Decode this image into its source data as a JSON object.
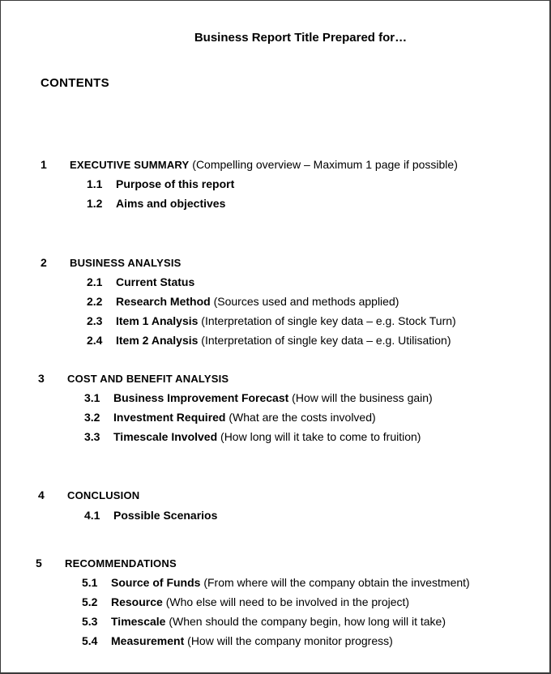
{
  "document": {
    "title": "Business Report Title Prepared for…",
    "contents_heading": "CONTENTS",
    "sections": [
      {
        "number": "1",
        "title": "EXECUTIVE SUMMARY",
        "note": " (Compelling overview – Maximum 1 page if possible)",
        "items": [
          {
            "number": "1.1",
            "title": "Purpose of this report",
            "note": ""
          },
          {
            "number": "1.2",
            "title": "Aims and objectives",
            "note": ""
          }
        ]
      },
      {
        "number": "2",
        "title": "BUSINESS ANALYSIS",
        "note": "",
        "items": [
          {
            "number": "2.1",
            "title": "Current Status",
            "note": ""
          },
          {
            "number": "2.2",
            "title": "Research Method",
            "note": " (Sources used and methods applied)"
          },
          {
            "number": "2.3",
            "title": "Item 1 Analysis",
            "note": " (Interpretation of single key data – e.g. Stock Turn)"
          },
          {
            "number": "2.4",
            "title": "Item 2 Analysis",
            "note": " (Interpretation of single key data – e.g. Utilisation)"
          }
        ]
      },
      {
        "number": "3",
        "title": "COST AND BENEFIT ANALYSIS",
        "note": "",
        "items": [
          {
            "number": "3.1",
            "title": "Business Improvement Forecast",
            "note": " (How will the business gain)"
          },
          {
            "number": "3.2",
            "title": "Investment Required",
            "note": " (What are the costs involved)"
          },
          {
            "number": "3.3",
            "title": "Timescale Involved",
            "note": " (How long will it take to come to fruition)"
          }
        ]
      },
      {
        "number": "4",
        "title": "CONCLUSION",
        "note": "",
        "items": [
          {
            "number": "4.1",
            "title": "Possible Scenarios",
            "note": ""
          }
        ]
      },
      {
        "number": "5",
        "title": "RECOMMENDATIONS",
        "note": "",
        "items": [
          {
            "number": "5.1",
            "title": "Source of Funds",
            "note": " (From where will the company obtain the investment)"
          },
          {
            "number": "5.2",
            "title": "Resource",
            "note": " (Who else will need to be involved in the project)"
          },
          {
            "number": "5.3",
            "title": "Timescale",
            "note": " (When should the company begin, how long will it take)"
          },
          {
            "number": "5.4",
            "title": "Measurement",
            "note": " (How will the company monitor progress)"
          }
        ]
      }
    ]
  }
}
